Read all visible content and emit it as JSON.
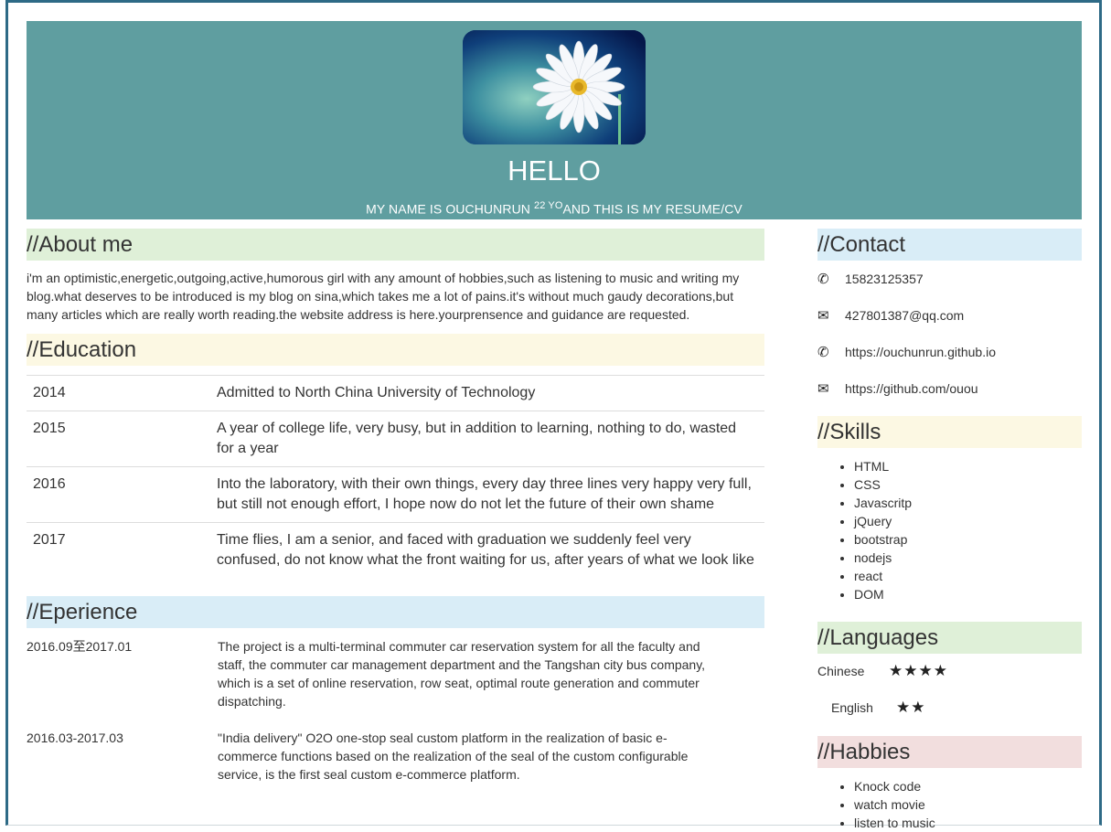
{
  "header": {
    "avatar_icon": "daisy-flower-photo",
    "title": "HELLO",
    "sub_prefix": "MY NAME IS OUCHUNRUN ",
    "sub_age": "22 YO",
    "sub_suffix": "AND THIS IS MY RESUME/CV"
  },
  "about": {
    "title": "//About me",
    "text": "i'm an optimistic,energetic,outgoing,active,humorous girl with any amount of hobbies,such as listening to music and writing my blog.what deserves to be introduced is my blog on sina,which takes me a lot of pains.it's without much gaudy decorations,but many articles which are really worth reading.the website address is here.yourprensence and guidance are requested."
  },
  "education": {
    "title": "//Education",
    "rows": [
      {
        "year": "2014",
        "text": "Admitted to North China University of Technology"
      },
      {
        "year": "2015",
        "text": "A year of college life, very busy, but in addition to learning, nothing to do, wasted for a year"
      },
      {
        "year": "2016",
        "text": "Into the laboratory, with their own things, every day three lines very happy very full, but still not enough effort, I hope now do not let the future of their own shame"
      },
      {
        "year": "2017",
        "text": "Time flies, I am a senior, and faced with graduation we suddenly feel very confused, do not know what the front waiting for us, after years of what we look like"
      }
    ]
  },
  "experience": {
    "title": "//Eperience",
    "items": [
      {
        "date": "2016.09至2017.01",
        "text": "The project is a multi-terminal commuter car reservation system for all the faculty and staff, the commuter car management department and the Tangshan city bus company, which is a set of online reservation, row seat, optimal route generation and commuter dispatching."
      },
      {
        "date": "2016.03-2017.03",
        "text": "\"India delivery\" O2O one-stop seal custom platform in the realization of basic e-commerce functions based on the realization of the seal of the custom configurable service, is the first seal custom e-commerce platform."
      }
    ]
  },
  "contact": {
    "title": "//Contact",
    "items": [
      {
        "icon": "phone-icon",
        "glyph": "✆",
        "text": "15823125357"
      },
      {
        "icon": "envelope-icon",
        "glyph": "✉",
        "text": "427801387@qq.com"
      },
      {
        "icon": "phone-icon",
        "glyph": "✆",
        "text": "https://ouchunrun.github.io"
      },
      {
        "icon": "envelope-icon",
        "glyph": "✉",
        "text": "https://github.com/ouou"
      }
    ]
  },
  "skills": {
    "title": "//Skills",
    "items": [
      "HTML",
      "CSS",
      "Javascritp",
      "jQuery",
      "bootstrap",
      "nodejs",
      "react",
      "DOM"
    ]
  },
  "languages": {
    "title": "//Languages",
    "items": [
      {
        "name": "Chinese",
        "stars": "★★★★",
        "level": 4
      },
      {
        "name": "English",
        "stars": "★★",
        "level": 2
      }
    ]
  },
  "hobbies": {
    "title": "//Habbies",
    "items": [
      "Knock code",
      "watch movie",
      "listen to music"
    ]
  },
  "colors": {
    "header_bg": "#5f9ea0",
    "frame_border": "#2e6a86",
    "green": "#dff0d8",
    "yellow": "#fcf8e3",
    "blue": "#d9edf7",
    "pink": "#f2dede"
  }
}
